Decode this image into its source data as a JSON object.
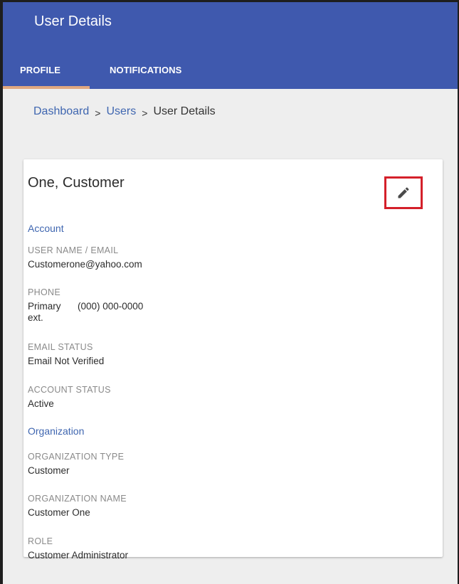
{
  "header": {
    "title": "User Details",
    "tabs": [
      {
        "label": "PROFILE",
        "active": true
      },
      {
        "label": "NOTIFICATIONS",
        "active": false
      }
    ]
  },
  "breadcrumb": {
    "items": [
      "Dashboard",
      "Users",
      "User Details"
    ],
    "separator": ">"
  },
  "card": {
    "name": "One, Customer",
    "edit_icon": "pencil-icon",
    "account": {
      "heading": "Account",
      "username_label": "USER NAME / EMAIL",
      "username_value": "Customerone@yahoo.com",
      "phone_label": "PHONE",
      "phone_type": "Primary",
      "phone_number": "(000) 000-0000",
      "phone_ext": "ext.",
      "email_status_label": "EMAIL STATUS",
      "email_status_value": "Email Not Verified",
      "account_status_label": "ACCOUNT STATUS",
      "account_status_value": "Active"
    },
    "organization": {
      "heading": "Organization",
      "type_label": "ORGANIZATION TYPE",
      "type_value": "Customer",
      "name_label": "ORGANIZATION NAME",
      "name_value": "Customer One",
      "role_label": "ROLE",
      "role_value": "Customer Administrator"
    }
  },
  "colors": {
    "app_bar": "#3f59ae",
    "tab_indicator": "#e0a880",
    "link": "#3f66b0",
    "highlight_box": "#d4202a",
    "background": "#eeeeee"
  }
}
